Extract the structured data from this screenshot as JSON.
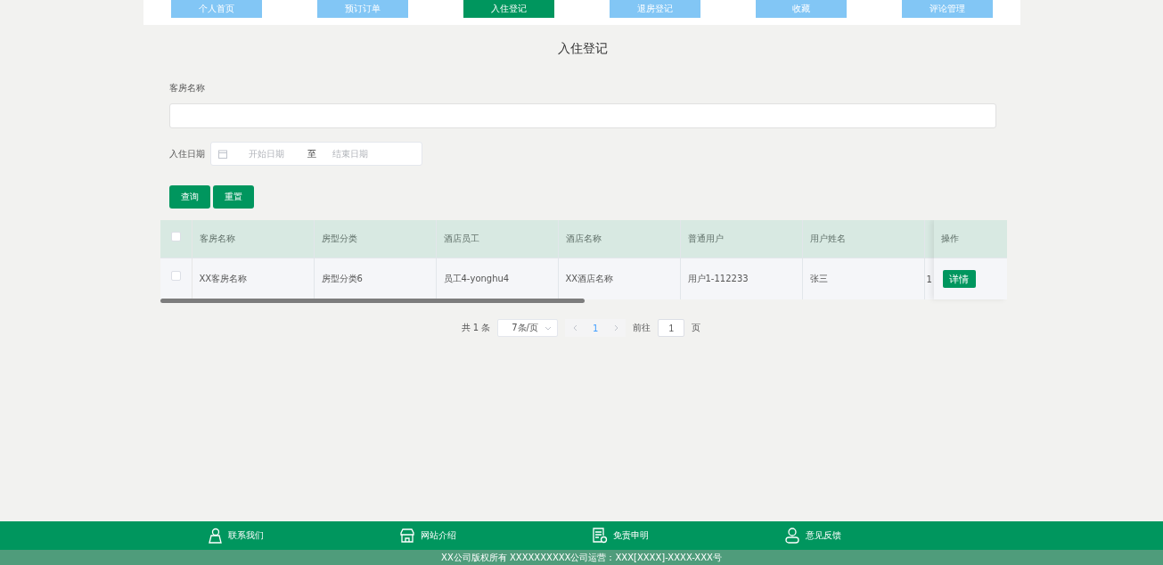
{
  "nav": [
    {
      "label": "个人首页",
      "selected": false
    },
    {
      "label": "预订订单",
      "selected": false
    },
    {
      "label": "入住登记",
      "selected": true
    },
    {
      "label": "退房登记",
      "selected": false
    },
    {
      "label": "收藏",
      "selected": false
    },
    {
      "label": "评论管理",
      "selected": false
    }
  ],
  "title": "入住登记",
  "filters": {
    "room_label": "客房名称",
    "date_label": "入住日期",
    "start_placeholder": "开始日期",
    "separator": "至",
    "end_placeholder": "结束日期"
  },
  "buttons": [
    "查询",
    "重置"
  ],
  "table": {
    "columns": [
      "客房名称",
      "房型分类",
      "酒店员工",
      "酒店名称",
      "普通用户",
      "用户姓名",
      ""
    ],
    "action_column": "操作",
    "all_checked": false,
    "rows": [
      {
        "checked": false,
        "cells": [
          "XX客房名称",
          "房型分类6",
          "员工4-yonghu4",
          "XX酒店名称",
          "用户1-112233",
          "张三",
          "1"
        ],
        "action": "详情"
      }
    ]
  },
  "pagination": {
    "total": "共 1 条",
    "page_size": "7条/页",
    "current": "1",
    "goto_label": "前往",
    "goto_value": "1",
    "page_suffix": "页"
  },
  "footer": {
    "links": [
      {
        "kind": "contact",
        "label": "联系我们"
      },
      {
        "kind": "about",
        "label": "网站介绍"
      },
      {
        "kind": "disclaimer",
        "label": "免责申明"
      },
      {
        "kind": "feedback",
        "label": "意见反馈"
      }
    ],
    "copyright": "XX公司版权所有 XXXXXXXXXX公司运营：XXX[XXXX]-XXXX-XXX号"
  }
}
